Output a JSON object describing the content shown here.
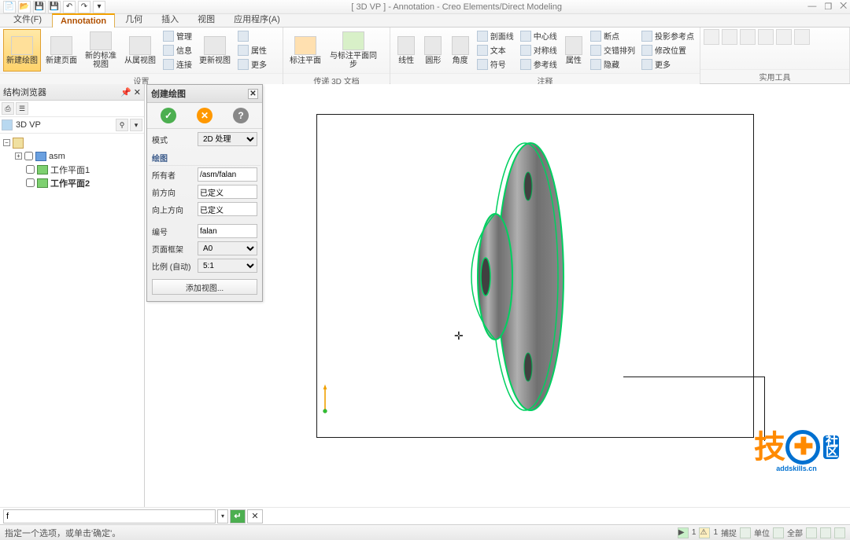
{
  "title": "[ 3D VP ] - Annotation - Creo Elements/Direct Modeling",
  "menu": {
    "file": "文件(F)"
  },
  "tabs": [
    "Annotation",
    "几何",
    "插入",
    "视图",
    "应用程序(A)"
  ],
  "ribbon": {
    "groups": {
      "setup": {
        "label": "设置",
        "new_drawing": "新建绘图",
        "new_page": "新建页面",
        "new_std_view": "新的标准视图",
        "dep_view": "从属视图",
        "manage": "管理",
        "info": "信息",
        "link": "连接",
        "update": "更新视图",
        "props": "属性",
        "more": "更多"
      },
      "transfer": {
        "label": "传递 3D 文档",
        "anno_plane": "标注平面",
        "sync": "与标注平面同步"
      },
      "annotate": {
        "label": "注释",
        "linear": "线性",
        "circular": "圆形",
        "angle": "角度",
        "section": "剖面线",
        "text": "文本",
        "symbol": "符号",
        "center": "中心线",
        "symline": "对称线",
        "refline": "参考线",
        "props2": "属性",
        "breakpt": "断点",
        "pattern": "交错排列",
        "hide": "隐藏",
        "proj_ref": "投影参考点",
        "modify_pos": "修改位置",
        "more2": "更多"
      },
      "tools": {
        "label": "实用工具"
      }
    }
  },
  "browser": {
    "title": "结构浏览器",
    "root": "3D VP",
    "asm": "asm",
    "wp1": "工作平面1",
    "wp2": "工作平面2"
  },
  "dialog": {
    "title": "创建绘图",
    "section1": "",
    "mode_label": "模式",
    "mode_value": "2D 处理",
    "section_draw": "绘图",
    "owner_label": "所有者",
    "owner_value": "/asm/falan",
    "front_label": "前方向",
    "front_value": "已定义",
    "up_label": "向上方向",
    "up_value": "已定义",
    "number_label": "编号",
    "number_value": "falan",
    "frame_label": "页面框架",
    "frame_value": "A0",
    "scale_label": "比例 (自动)",
    "scale_value": "5:1",
    "add_view": "添加视图..."
  },
  "cmd": {
    "value": "f"
  },
  "status": {
    "prompt": "指定一个选项，或单击'确定'。",
    "r_items": [
      "1",
      "1",
      "捕捉",
      "单位",
      "全部"
    ]
  },
  "watermark": {
    "han": "技",
    "sub": "addskills.cn",
    "badge1": "社",
    "badge2": "区"
  }
}
